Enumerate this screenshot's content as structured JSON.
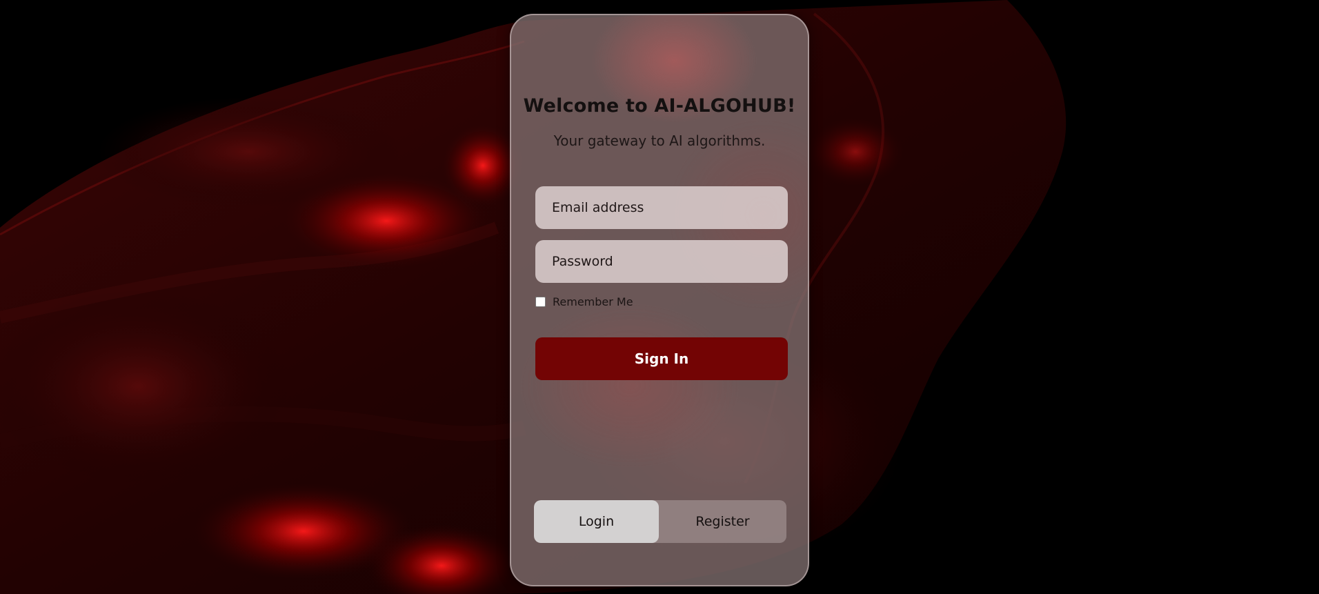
{
  "theme": {
    "accent": "#730404",
    "background": "#000000",
    "card_tint": "#807070"
  },
  "login": {
    "title": "Welcome to AI-ALGOHUB!",
    "subtitle": "Your gateway to AI algorithms.",
    "email_placeholder": "Email address",
    "email_value": "",
    "password_placeholder": "Password",
    "password_value": "",
    "remember_label": "Remember Me",
    "remember_checked": false,
    "signin_label": "Sign In"
  },
  "tabs": [
    {
      "label": "Login",
      "active": true
    },
    {
      "label": "Register",
      "active": false
    }
  ]
}
